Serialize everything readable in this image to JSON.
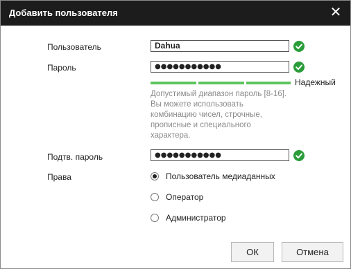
{
  "dialog": {
    "title": "Добавить пользователя"
  },
  "form": {
    "user_label": "Пользователь",
    "user_value": "Dahua",
    "password_label": "Пароль",
    "password_value": "●●●●●●●●●●●",
    "strength_label": "Надежный",
    "hint": "Допустимый диапазон пароль [8-16]. Вы можете использовать комбинацию чисел, строчные, прописные и специального характера.",
    "confirm_label": "Подтв. пароль",
    "confirm_value": "●●●●●●●●●●●",
    "rights_label": "Права",
    "rights_options": [
      {
        "label": "Пользователь медиаданных",
        "selected": true
      },
      {
        "label": "Оператор",
        "selected": false
      },
      {
        "label": "Администратор",
        "selected": false
      }
    ]
  },
  "buttons": {
    "ok": "ОК",
    "cancel": "Отмена"
  },
  "colors": {
    "titlebar": "#1c1c1c",
    "check": "#2a9d3a",
    "strength": "#5ec35e",
    "hint": "#8a8a8a"
  },
  "icons": {
    "close": "close-icon",
    "valid": "check-circle-icon"
  }
}
